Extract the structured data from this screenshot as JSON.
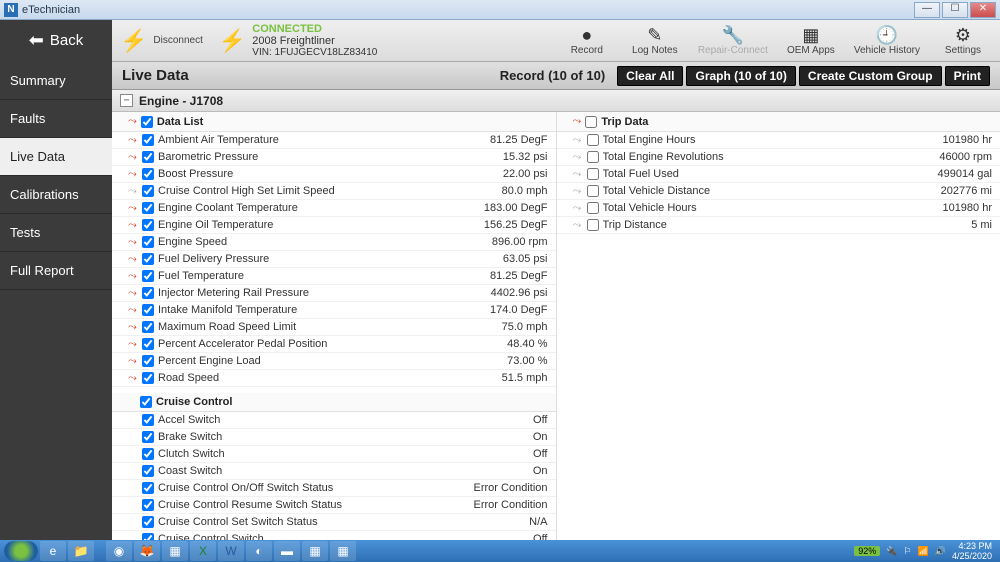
{
  "window": {
    "title": "eTechnician"
  },
  "toolbar": {
    "back": "Back",
    "disconnect": "Disconnect",
    "status": "CONNECTED",
    "vehicle": "2008 Freightliner",
    "vin": "VIN: 1FUJGECV18LZ83410",
    "items": [
      {
        "label": "Record",
        "icon": "●",
        "disabled": false
      },
      {
        "label": "Log Notes",
        "icon": "✎",
        "disabled": false
      },
      {
        "label": "Repair-Connect",
        "icon": "🔧",
        "disabled": true
      },
      {
        "label": "OEM Apps",
        "icon": "▦",
        "disabled": false
      },
      {
        "label": "Vehicle History",
        "icon": "🕘",
        "disabled": false
      },
      {
        "label": "Settings",
        "icon": "⚙",
        "disabled": false
      }
    ]
  },
  "sidebar": [
    "Summary",
    "Faults",
    "Live Data",
    "Calibrations",
    "Tests",
    "Full Report"
  ],
  "sidebar_active": 2,
  "page": {
    "title": "Live Data",
    "record_status": "Record (10 of 10)",
    "buttons": [
      "Clear All",
      "Graph (10 of 10)",
      "Create Custom Group",
      "Print"
    ],
    "group": "Engine - J1708"
  },
  "data_list": {
    "title": "Data List",
    "rows": [
      {
        "name": "Ambient Air Temperature",
        "value": "81.25 DegF",
        "checked": true
      },
      {
        "name": "Barometric Pressure",
        "value": "15.32 psi",
        "checked": true
      },
      {
        "name": "Boost Pressure",
        "value": "22.00 psi",
        "checked": true
      },
      {
        "name": "Cruise Control High Set Limit Speed",
        "value": "80.0 mph",
        "checked": true,
        "nograph": true
      },
      {
        "name": "Engine Coolant Temperature",
        "value": "183.00 DegF",
        "checked": true
      },
      {
        "name": "Engine Oil Temperature",
        "value": "156.25 DegF",
        "checked": true
      },
      {
        "name": "Engine Speed",
        "value": "896.00 rpm",
        "checked": true
      },
      {
        "name": "Fuel Delivery Pressure",
        "value": "63.05 psi",
        "checked": true
      },
      {
        "name": "Fuel Temperature",
        "value": "81.25 DegF",
        "checked": true
      },
      {
        "name": "Injector Metering Rail Pressure",
        "value": "4402.96 psi",
        "checked": true
      },
      {
        "name": "Intake Manifold Temperature",
        "value": "174.0 DegF",
        "checked": true
      },
      {
        "name": "Maximum Road Speed Limit",
        "value": "75.0 mph",
        "checked": true
      },
      {
        "name": "Percent Accelerator Pedal Position",
        "value": "48.40 %",
        "checked": true
      },
      {
        "name": "Percent Engine Load",
        "value": "73.00 %",
        "checked": true
      },
      {
        "name": "Road Speed",
        "value": "51.5 mph",
        "checked": true
      }
    ]
  },
  "cruise": {
    "title": "Cruise Control",
    "rows": [
      {
        "name": "Accel Switch",
        "value": "Off",
        "checked": true
      },
      {
        "name": "Brake Switch",
        "value": "On",
        "checked": true
      },
      {
        "name": "Clutch Switch",
        "value": "Off",
        "checked": true
      },
      {
        "name": "Coast Switch",
        "value": "On",
        "checked": true
      },
      {
        "name": "Cruise Control On/Off Switch Status",
        "value": "Error Condition",
        "checked": true
      },
      {
        "name": "Cruise Control Resume Switch Status",
        "value": "Error Condition",
        "checked": true
      },
      {
        "name": "Cruise Control Set Switch Status",
        "value": "N/A",
        "checked": true
      },
      {
        "name": "Cruise Control Switch",
        "value": "Off",
        "checked": true
      }
    ]
  },
  "trip": {
    "title": "Trip Data",
    "rows": [
      {
        "name": "Total Engine Hours",
        "value": "101980 hr"
      },
      {
        "name": "Total Engine Revolutions",
        "value": "46000 rpm"
      },
      {
        "name": "Total Fuel Used",
        "value": "499014 gal"
      },
      {
        "name": "Total Vehicle Distance",
        "value": "202776 mi"
      },
      {
        "name": "Total Vehicle Hours",
        "value": "101980 hr"
      },
      {
        "name": "Trip Distance",
        "value": "5 mi"
      }
    ]
  },
  "taskbar": {
    "battery": "92%",
    "time": "4:23 PM",
    "date": "4/25/2020"
  }
}
